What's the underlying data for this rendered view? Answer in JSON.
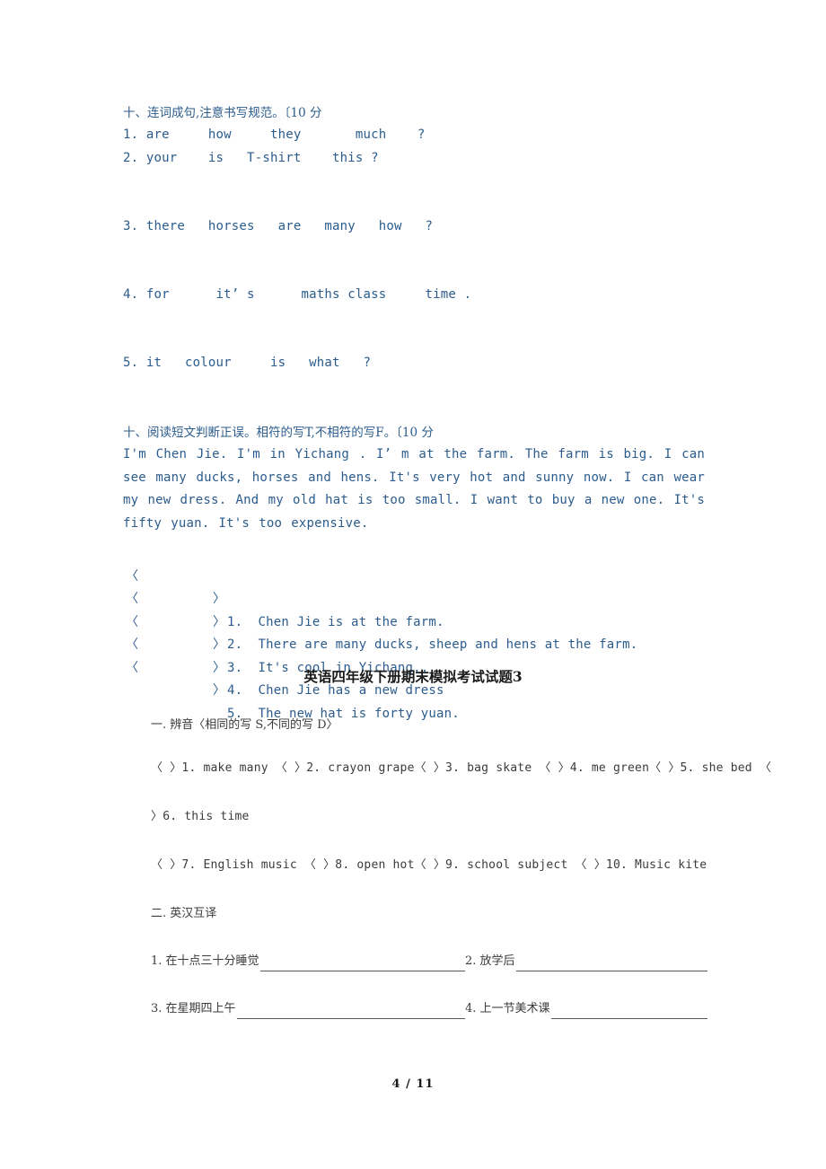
{
  "page": {
    "footer": "4 / 11",
    "colors": {
      "body_blue": "#2b5c8d",
      "body_dark": "#3b3b3b",
      "title_black": "#1a1a1a",
      "background": "#ffffff"
    }
  },
  "section_word_order": {
    "heading": "十、连词成句,注意书写规范。〔10 分",
    "items": [
      "1. are     how     they       much    ?",
      "2. your    is   T-shirt    this ?",
      "3. there   horses   are   many   how   ?",
      "4. for      it’ s      maths class     time .",
      "5. it   colour     is   what   ?"
    ]
  },
  "section_reading": {
    "heading": "十、阅读短文判断正误。相符的写T,不相符的写F。〔10 分",
    "passage": "I'm Chen Jie. I'm in Yichang . I’ m at the farm. The farm is big. I can see many ducks, horses and hens. It's very hot and sunny now. I can wear my new dress. And my old hat is too small. I want to buy a new one. It's fifty yuan. It's too expensive.",
    "bracket_left": "〈",
    "bracket_right": "〉",
    "statements": [
      "1.  Chen Jie is at the farm.",
      "2.  There are many ducks, sheep and hens at the farm.",
      "3.  It's cool in Yichang..",
      "4.  Chen Jie has a new dress",
      "5.  The new hat is forty yuan."
    ]
  },
  "paper3": {
    "title": "英语四年级下册期末模拟考试试题3",
    "section_phonics": {
      "heading": "一. 辨音〈相同的写 S,不同的写 D〉",
      "lines": [
        "〈 〉1. make many 〈 〉2. crayon grape〈 〉3. bag skate 〈 〉4. me green〈 〉5. she bed 〈",
        "〉6. this time",
        "〈 〉7. English music 〈 〉8. open hot〈 〉9. school subject 〈 〉10. Music kite"
      ]
    },
    "section_translate": {
      "heading": "二. 英汉互译",
      "rows": [
        {
          "left_label": "1. 在十点三十分睡觉",
          "right_label": "2. 放学后"
        },
        {
          "left_label": "3. 在星期四上午",
          "right_label": "4. 上一节美术课"
        }
      ]
    }
  }
}
